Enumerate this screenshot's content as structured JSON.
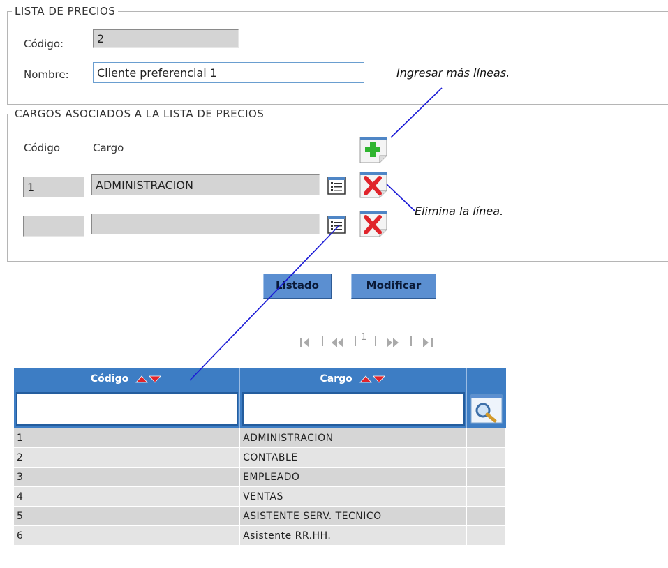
{
  "section_lista": {
    "legend": "LISTA DE PRECIOS",
    "codigo_label": "Código:",
    "codigo_value": "2",
    "nombre_label": "Nombre:",
    "nombre_value": "Cliente preferencial 1"
  },
  "section_cargos": {
    "legend": "CARGOS ASOCIADOS A LA LISTA DE PRECIOS",
    "col_codigo": "Código",
    "col_cargo": "Cargo",
    "lines": [
      {
        "codigo": "1",
        "cargo": "ADMINISTRACION"
      },
      {
        "codigo": "",
        "cargo": ""
      }
    ]
  },
  "annotations": {
    "add_lines": "Ingresar más líneas.",
    "delete_line": "Elimina la línea."
  },
  "buttons": {
    "listado": "Listado",
    "modificar": "Modificar"
  },
  "pager": {
    "current_page": "1"
  },
  "grid": {
    "headers": [
      "Código",
      "Cargo"
    ],
    "filters": {
      "codigo": "",
      "cargo": ""
    },
    "rows": [
      {
        "codigo": "1",
        "cargo": "ADMINISTRACION"
      },
      {
        "codigo": "2",
        "cargo": "CONTABLE"
      },
      {
        "codigo": "3",
        "cargo": "EMPLEADO"
      },
      {
        "codigo": "4",
        "cargo": "VENTAS"
      },
      {
        "codigo": "5",
        "cargo": "ASISTENTE SERV. TECNICO"
      },
      {
        "codigo": "6",
        "cargo": "Asistente RR.HH."
      }
    ]
  },
  "colors": {
    "grid_header": "#3d7dc4",
    "button": "#5b8fd1",
    "annotation_line": "#1a1ad6",
    "delete_icon": "#e0242b",
    "add_icon": "#2fb52f"
  },
  "icons": [
    "add-line-icon",
    "delete-line-icon",
    "list-lookup-icon",
    "search-icon",
    "sort-asc-icon",
    "sort-desc-icon",
    "first-page-icon",
    "prev-page-icon",
    "next-page-icon",
    "last-page-icon"
  ]
}
